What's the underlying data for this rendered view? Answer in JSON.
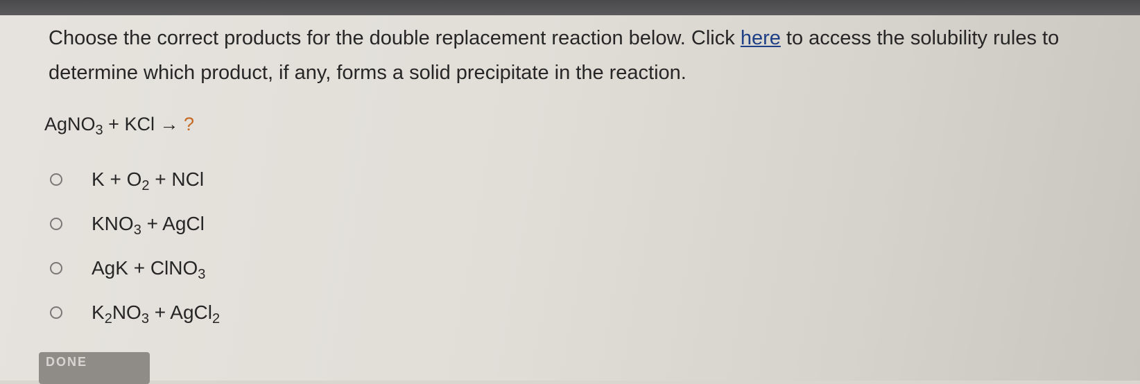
{
  "question": {
    "text_before_link": "Choose the correct products for the double replacement reaction below. Click ",
    "link_text": "here",
    "text_after_link": " to access the solubility rules to determine which product, if any, forms a solid precipitate in the reaction."
  },
  "equation": {
    "reactant1": "AgNO",
    "reactant1_sub": "3",
    "plus": "+",
    "reactant2": "KCl",
    "arrow": "→",
    "product": "?"
  },
  "options": [
    {
      "parts": [
        "K + O",
        "2",
        " + NCl"
      ]
    },
    {
      "parts": [
        "KNO",
        "3",
        " + AgCl"
      ]
    },
    {
      "parts": [
        "AgK + ClNO",
        "3",
        ""
      ]
    },
    {
      "parts": [
        "K",
        "2",
        "NO",
        "3",
        " + AgCl",
        "2"
      ]
    }
  ],
  "done_button": {
    "label": "DONE"
  },
  "colors": {
    "link": "#1e3f85",
    "question_mark": "#c46a26",
    "background": "#e1ded8"
  }
}
